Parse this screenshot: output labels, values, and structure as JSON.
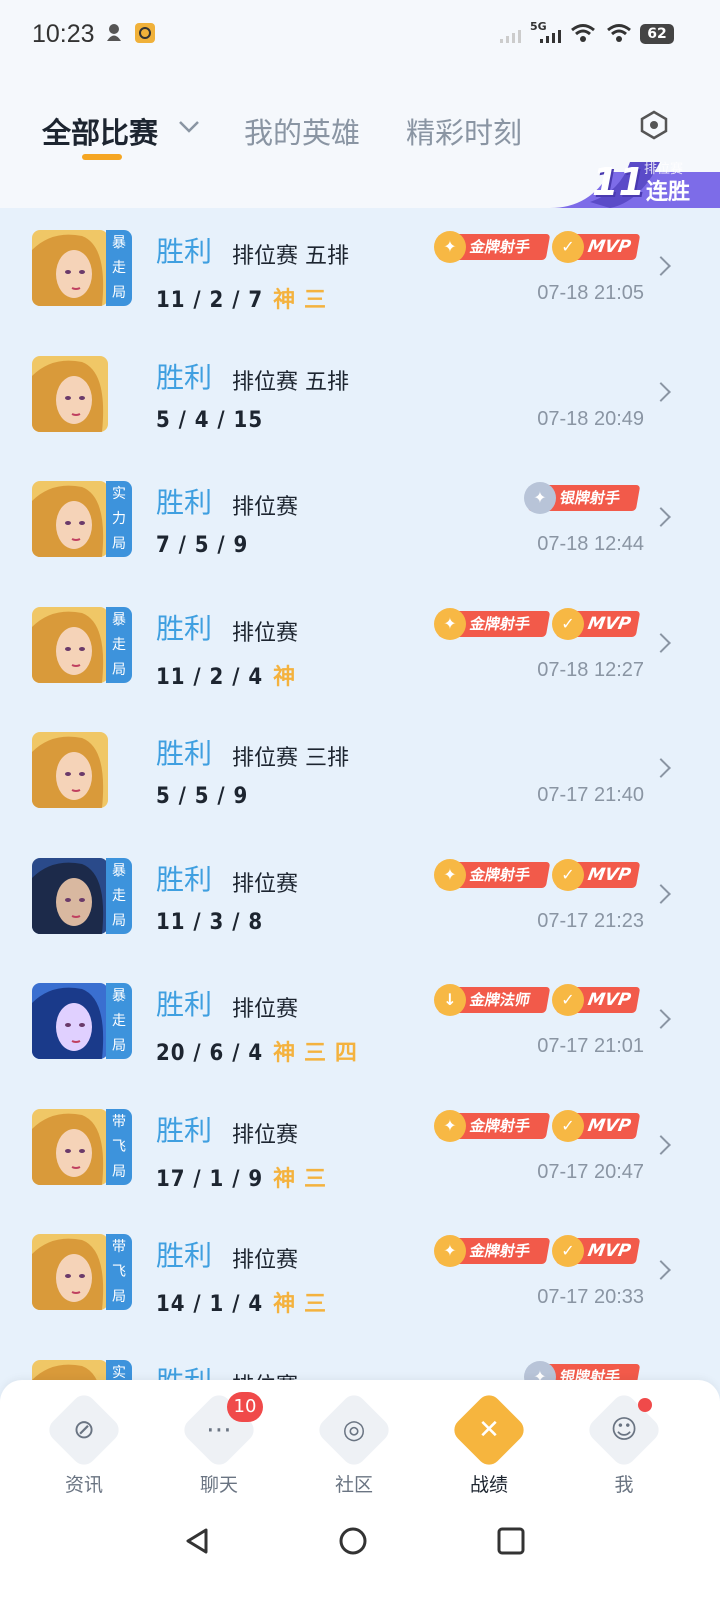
{
  "status": {
    "time": "10:23",
    "network": "5G",
    "battery": "62"
  },
  "tabs": [
    {
      "label": "全部比赛",
      "active": true
    },
    {
      "label": "我的英雄",
      "active": false
    },
    {
      "label": "精彩时刻",
      "active": false
    }
  ],
  "streak": {
    "count": "11",
    "top": "排位赛",
    "label": "连胜"
  },
  "matches": [
    {
      "tag": "暴走局",
      "result": "胜利",
      "mode": "排位赛 五排",
      "kda": "11 / 2 / 7",
      "honors": "神 三",
      "date": "07-18 21:05",
      "badges": [
        "金牌射手",
        "MVP"
      ]
    },
    {
      "tag": "",
      "result": "胜利",
      "mode": "排位赛 五排",
      "kda": "5 / 4 / 15",
      "honors": "",
      "date": "07-18 20:49",
      "badges": []
    },
    {
      "tag": "实力局",
      "result": "胜利",
      "mode": "排位赛",
      "kda": "7 / 5 / 9",
      "honors": "",
      "date": "07-18 12:44",
      "badges": [
        "银牌射手"
      ]
    },
    {
      "tag": "暴走局",
      "result": "胜利",
      "mode": "排位赛",
      "kda": "11 / 2 / 4",
      "honors": "神",
      "date": "07-18 12:27",
      "badges": [
        "金牌射手",
        "MVP"
      ]
    },
    {
      "tag": "",
      "result": "胜利",
      "mode": "排位赛 三排",
      "kda": "5 / 5 / 9",
      "honors": "",
      "date": "07-17 21:40",
      "badges": []
    },
    {
      "tag": "暴走局",
      "result": "胜利",
      "mode": "排位赛",
      "kda": "11 / 3 / 8",
      "honors": "",
      "date": "07-17 21:23",
      "badges": [
        "金牌射手",
        "MVP"
      ]
    },
    {
      "tag": "暴走局",
      "result": "胜利",
      "mode": "排位赛",
      "kda": "20 / 6 / 4",
      "honors": "神 三 四",
      "date": "07-17 21:01",
      "badges": [
        "金牌法师",
        "MVP"
      ]
    },
    {
      "tag": "带飞局",
      "result": "胜利",
      "mode": "排位赛",
      "kda": "17 / 1 / 9",
      "honors": "神 三",
      "date": "07-17 20:47",
      "badges": [
        "金牌射手",
        "MVP"
      ]
    },
    {
      "tag": "带飞局",
      "result": "胜利",
      "mode": "排位赛",
      "kda": "14 / 1 / 4",
      "honors": "神 三",
      "date": "07-17 20:33",
      "badges": [
        "金牌射手",
        "MVP"
      ]
    },
    {
      "tag": "实",
      "result": "胜利",
      "mode": "排位赛",
      "kda": "",
      "honors": "",
      "date": "",
      "badges": [
        "银牌射手"
      ]
    }
  ],
  "nav": [
    {
      "label": "资讯",
      "icon": "news-icon",
      "badge": "",
      "dot": false,
      "active": false
    },
    {
      "label": "聊天",
      "icon": "chat-icon",
      "badge": "10",
      "dot": false,
      "active": false
    },
    {
      "label": "社区",
      "icon": "community-icon",
      "badge": "",
      "dot": false,
      "active": false
    },
    {
      "label": "战绩",
      "icon": "battle-record-icon",
      "badge": "",
      "dot": false,
      "active": true
    },
    {
      "label": "我",
      "icon": "profile-icon",
      "badge": "",
      "dot": true,
      "active": false
    }
  ],
  "colors": {
    "win": "#3f9fe0",
    "accent": "#f6b53e",
    "badge_red": "#f25a4a",
    "tag_blue": "#3d93dc"
  }
}
